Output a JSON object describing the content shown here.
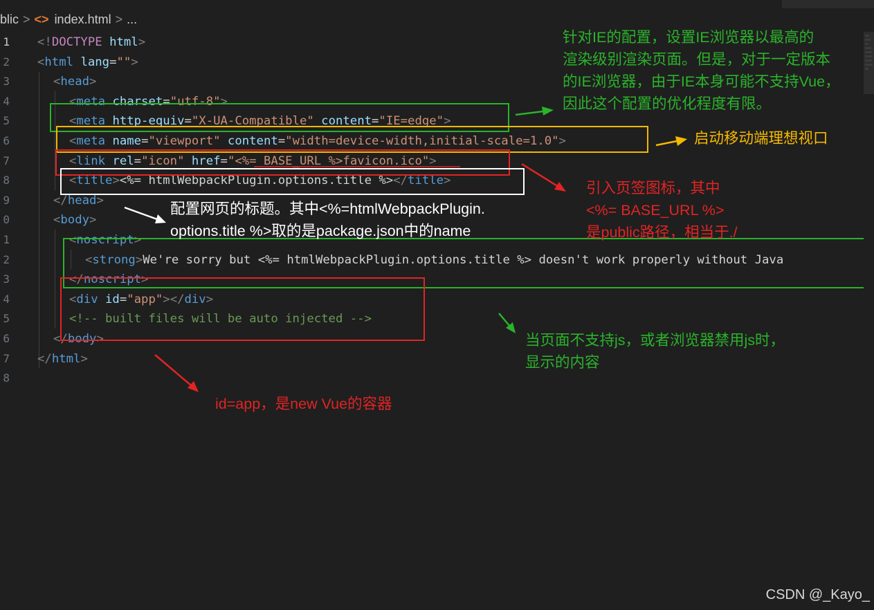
{
  "breadcrumb": {
    "folder": "blic",
    "separator": ">",
    "file_icon": "<>",
    "file": "index.html",
    "separator2": ">",
    "more": "..."
  },
  "line_numbers": [
    "1",
    "2",
    "3",
    "4",
    "5",
    "6",
    "7",
    "8",
    "9",
    "0",
    "1",
    "2",
    "3",
    "4",
    "5",
    "6",
    "7",
    "8"
  ],
  "code": {
    "l1": [
      "<!",
      "DOCTYPE",
      " ",
      "html",
      ">"
    ],
    "l2": [
      "<",
      "html",
      " ",
      "lang",
      "=",
      "\"\"",
      ">"
    ],
    "l3": [
      "<",
      "head",
      ">"
    ],
    "l4": [
      "<",
      "meta",
      " ",
      "charset",
      "=",
      "\"utf-8\"",
      ">"
    ],
    "l5": [
      "<",
      "meta",
      " ",
      "http-equiv",
      "=",
      "\"X-UA-Compatible\"",
      " ",
      "content",
      "=",
      "\"IE=edge\"",
      ">"
    ],
    "l6": [
      "<",
      "meta",
      " ",
      "name",
      "=",
      "\"viewport\"",
      " ",
      "content",
      "=",
      "\"width=device-width,initial-scale=1.0\"",
      ">"
    ],
    "l7": [
      "<",
      "link",
      " ",
      "rel",
      "=",
      "\"icon\"",
      " ",
      "href",
      "=",
      "\"",
      "<%= BASE_URL %>",
      "favicon.ico\"",
      ">"
    ],
    "l8": [
      "<",
      "title",
      ">",
      "<%= htmlWebpackPlugin.options.title %>",
      "</",
      "title",
      ">"
    ],
    "l9": [
      "</",
      "head",
      ">"
    ],
    "l10": [
      "<",
      "body",
      ">"
    ],
    "l11": [
      "<",
      "noscript",
      ">"
    ],
    "l12": [
      "<",
      "strong",
      ">",
      "We're sorry but ",
      "<%= htmlWebpackPlugin.options.title %>",
      " doesn't work properly without Java"
    ],
    "l13": [
      "</",
      "noscript",
      ">"
    ],
    "l14": [
      "<",
      "div",
      " ",
      "id",
      "=",
      "\"app\"",
      ">",
      "</",
      "div",
      ">"
    ],
    "l15": [
      "<!-- built files will be auto injected -->"
    ],
    "l16": [
      "</",
      "body",
      ">"
    ],
    "l17": [
      "</",
      "html",
      ">"
    ]
  },
  "annotations": {
    "ie_config": "针对IE的配置，设置IE浏览器以最高的渲染级别渲染页面。但是，对于一定版本的IE浏览器，由于IE本身可能不支持Vue，因此这个配置的优化程度有限。",
    "ie_config_lines": [
      "针对IE的配置，设置IE浏览器以最高的",
      "渲染级别渲染页面。但是，对于一定版本",
      "的IE浏览器，由于IE本身可能不支持Vue，",
      "因此这个配置的优化程度有限。"
    ],
    "viewport": "启动移动端理想视口",
    "favicon_lines": [
      "引入页签图标，其中",
      "<%= BASE_URL %>",
      "是public路径，相当于./"
    ],
    "title_lines": [
      "配置网页的标题。其中<%=htmlWebpackPlugin.",
      "options.title %>取的是package.json中的name"
    ],
    "noscript_lines": [
      "当页面不支持js，或者浏览器禁用js时，",
      "显示的内容"
    ],
    "app": "id=app，是new Vue的容器"
  },
  "colors": {
    "green": "#2bb32b",
    "yellow": "#f5b800",
    "red": "#e12424",
    "white": "#ffffff"
  },
  "watermark": "CSDN @_Kayo_"
}
